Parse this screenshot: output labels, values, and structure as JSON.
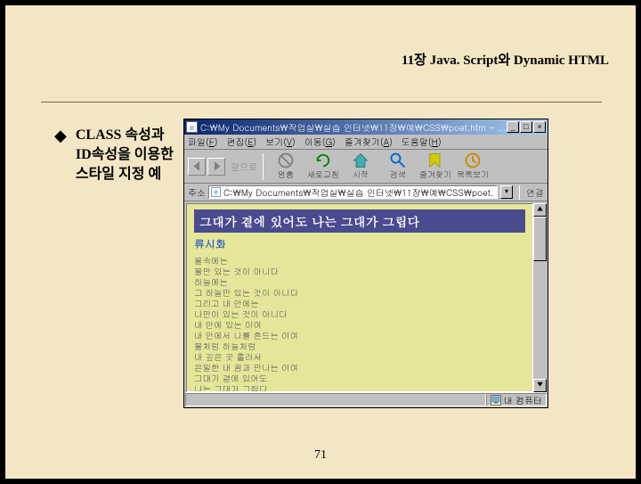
{
  "header": {
    "title": "11장 Java. Script와 Dynamic HTML"
  },
  "bullet": {
    "marker": "◆",
    "text": "CLASS 속성과 ID속성을 이용한 스타일 지정 예"
  },
  "browser": {
    "title": "C:\\My Documents\\작업실\\실습 인터넷\\11장\\예\\CSS\\poet.htm - ...",
    "window_buttons": {
      "min": "_",
      "max": "□",
      "close": "×"
    },
    "menu": [
      {
        "label": "파일",
        "key": "F"
      },
      {
        "label": "편집",
        "key": "E"
      },
      {
        "label": "보기",
        "key": "V"
      },
      {
        "label": "이동",
        "key": "G"
      },
      {
        "label": "즐겨찾기",
        "key": "A"
      },
      {
        "label": "도움말",
        "key": "H"
      }
    ],
    "toolbar": {
      "pre_label": "앞으로",
      "items": [
        {
          "name": "stop",
          "label": "멈춤"
        },
        {
          "name": "refresh",
          "label": "새로고침"
        },
        {
          "name": "home",
          "label": "시작"
        },
        {
          "name": "search",
          "label": "검색"
        },
        {
          "name": "favorites",
          "label": "즐겨찾기"
        },
        {
          "name": "history",
          "label": "목록보기"
        }
      ]
    },
    "address": {
      "label": "주소",
      "value": "C:\\My Documents\\작업실\\실습 인터넷\\11장\\예\\CSS\\poet.",
      "dropdown": "▾",
      "links_label": "연결"
    },
    "page": {
      "banner": "그대가 곁에 있어도 나는 그대가 그립다",
      "author": "류시화",
      "poem": "물속에는\n물만 있는 것이 아니다\n하늘에는\n그 하늘만 있는 것이 아니다\n그리고 내 안에는\n나만이 있는 것이 아니다\n내 안에 있는 이여\n내 안에서 나를 흔드는 이여\n물처럼 하늘처럼\n내 깊은 곳 흘러서\n은밀한 내 꿈과 만나는 이여\n그대가 곁에 있어도\n나는 그대가 그립다."
    },
    "status": {
      "zone": "내 컴퓨터",
      "icon_hint": "🖥"
    },
    "scroll": {
      "up": "▲",
      "down": "▼"
    }
  },
  "page_number": "71"
}
